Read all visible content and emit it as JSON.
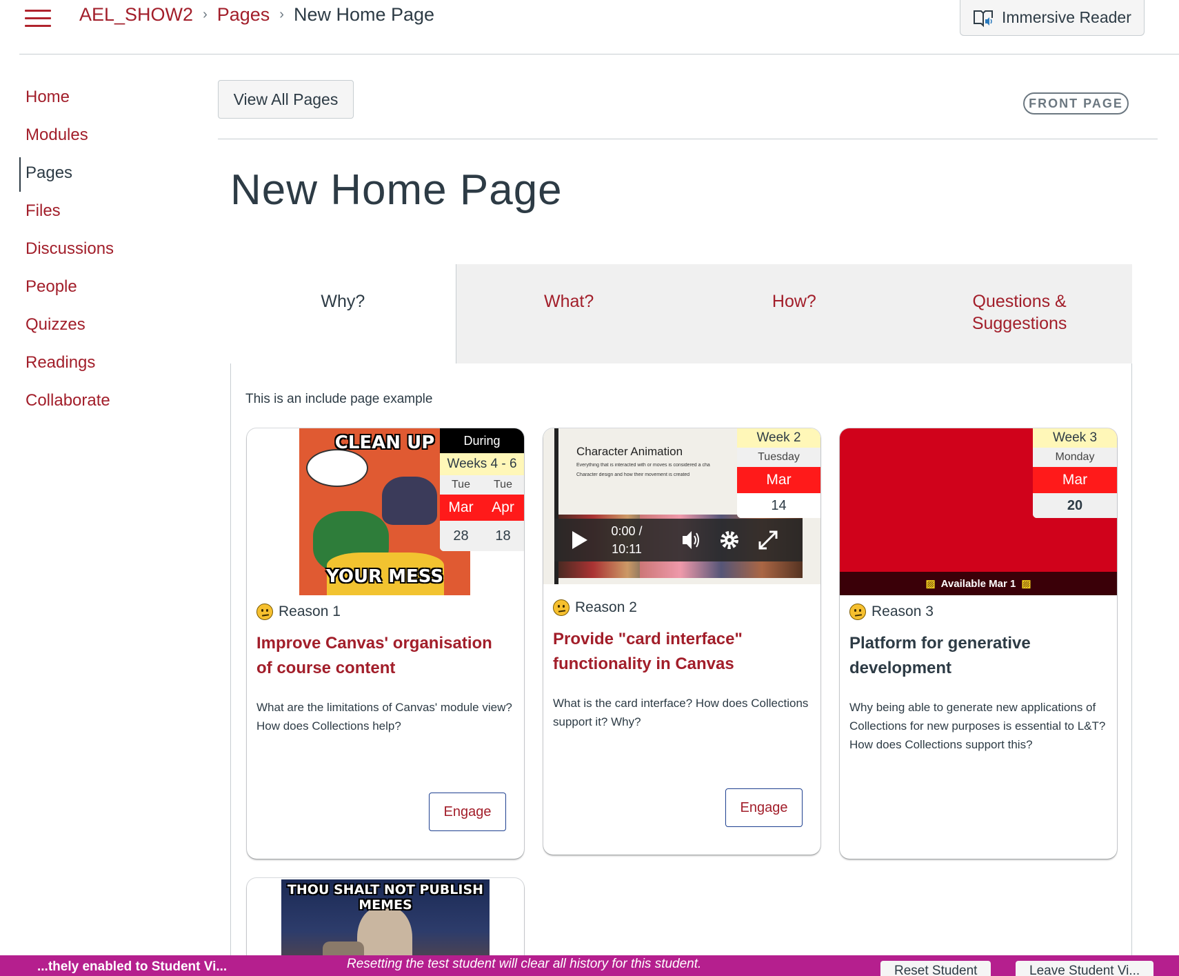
{
  "header": {
    "breadcrumbs": [
      "AEL_SHOW2",
      "Pages",
      "New Home Page"
    ],
    "immersive_reader": "Immersive Reader"
  },
  "sidebar": {
    "items": [
      {
        "label": "Home"
      },
      {
        "label": "Modules"
      },
      {
        "label": "Pages",
        "active": true
      },
      {
        "label": "Files"
      },
      {
        "label": "Discussions"
      },
      {
        "label": "People"
      },
      {
        "label": "Quizzes"
      },
      {
        "label": "Readings"
      },
      {
        "label": "Collaborate"
      }
    ]
  },
  "content": {
    "view_all_pages": "View All Pages",
    "front_page_badge": "FRONT PAGE",
    "page_title": "New Home Page",
    "tabs": [
      {
        "label": "Why?",
        "active": true
      },
      {
        "label": "What?"
      },
      {
        "label": "How?"
      },
      {
        "label": "Questions & Suggestions"
      }
    ],
    "intro": "This is an include page example"
  },
  "cards": [
    {
      "meme_top": "CLEAN UP",
      "meme_bottom": "YOUR MESS",
      "date": {
        "header": "During",
        "weeks": "Weeks 4 - 6",
        "days": [
          "Tue",
          "Tue"
        ],
        "months": [
          "Mar",
          "Apr"
        ],
        "dates": [
          "28",
          "18"
        ]
      },
      "reason": "Reason 1",
      "title": "Improve Canvas' organisation of course content",
      "description": "What are the  limitations of Canvas' module view? How does Collections help?",
      "button": "Engage"
    },
    {
      "slide_title": "Character Animation",
      "slide_bullets": [
        "Everything that is interacted with or moves is considered a cha",
        "Character design and how their movement is created"
      ],
      "video_time": "0:00 /",
      "video_duration": "10:11",
      "date": {
        "week": "Week 2",
        "day": "Tuesday",
        "month": "Mar",
        "date": "14"
      },
      "reason": "Reason 2",
      "title": "Provide \"card interface\" functionality in Canvas",
      "description": "What is the card interface? How does Collections support it? Why?",
      "button": "Engage"
    },
    {
      "available": "Available Mar 1",
      "date": {
        "week": "Week 3",
        "day": "Monday",
        "month": "Mar",
        "date": "20"
      },
      "reason": "Reason 3",
      "title": "Platform for generative development",
      "description": "Why being able to generate new applications of Collections for new purposes is essential to L&T? How does Collections support this?"
    },
    {
      "meme_top": "THOU SHALT NOT PUBLISH MEMES"
    }
  ],
  "banner": {
    "left": "...thely enabled to Student Vi...",
    "message": "Resetting the test student will clear all history for this student.",
    "reset_button": "Reset Student",
    "leave_button": "Leave Student Vi..."
  },
  "colors": {
    "brand": "#a21e2a",
    "text": "#2d3b45",
    "banner": "#b51f8e",
    "date_red": "#ff1a1a"
  }
}
